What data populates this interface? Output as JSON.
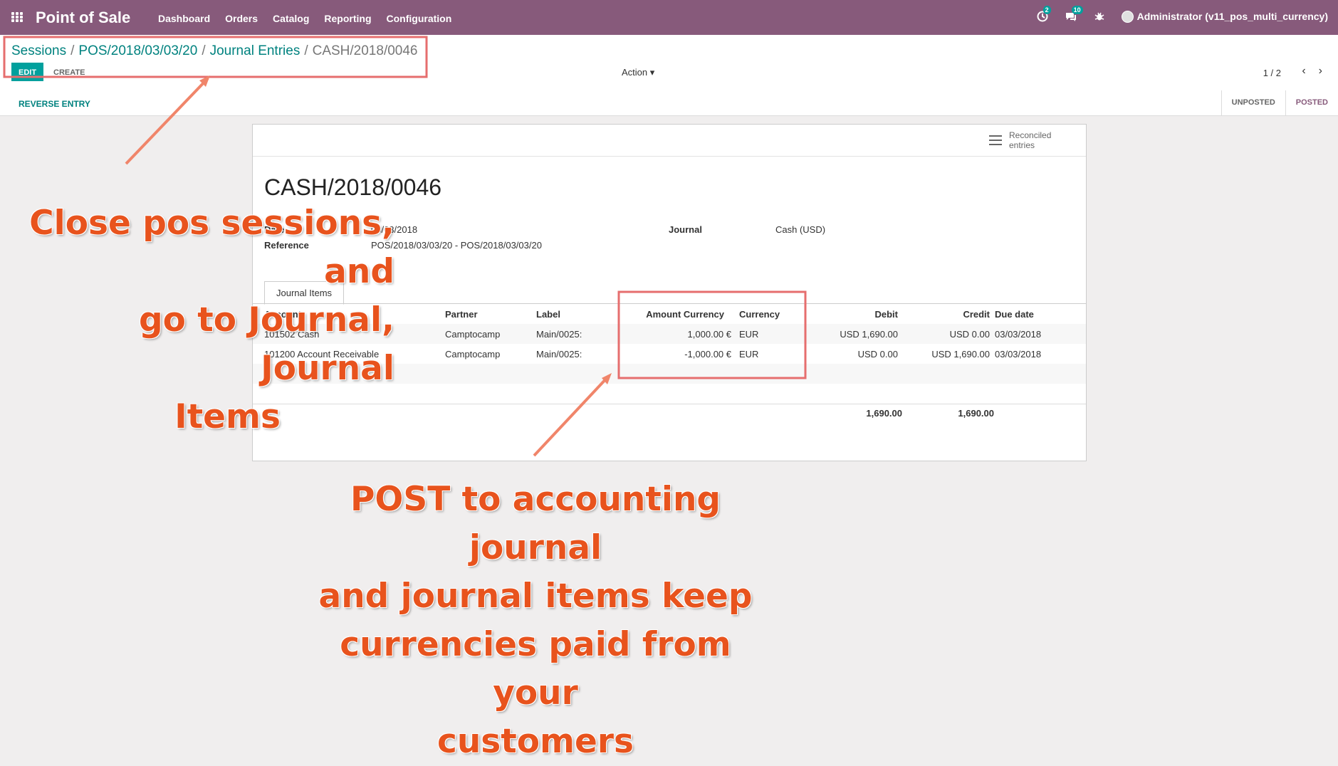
{
  "navbar": {
    "app_name": "Point of Sale",
    "menu": [
      "Dashboard",
      "Orders",
      "Catalog",
      "Reporting",
      "Configuration"
    ],
    "activity_count": "2",
    "messages_count": "10",
    "user": "Administrator (v11_pos_multi_currency)"
  },
  "breadcrumb": {
    "items": [
      "Sessions",
      "POS/2018/03/03/20",
      "Journal Entries"
    ],
    "current": "CASH/2018/0046"
  },
  "buttons": {
    "edit": "EDIT",
    "create": "CREATE",
    "action": "Action",
    "reverse": "REVERSE ENTRY"
  },
  "pager": {
    "value": "1 / 2"
  },
  "states": [
    "UNPOSTED",
    "POSTED"
  ],
  "stat_button": {
    "label": "Reconciled entries"
  },
  "record": {
    "name": "CASH/2018/0046",
    "date_label": "Date",
    "date_value": "03/03/2018",
    "reference_label": "Reference",
    "reference_value": "POS/2018/03/03/20 - POS/2018/03/03/20",
    "journal_label": "Journal",
    "journal_value": "Cash (USD)"
  },
  "tab": {
    "label": "Journal Items"
  },
  "table": {
    "headers": [
      "Account",
      "Partner",
      "Label",
      "Amount Currency",
      "Currency",
      "Debit",
      "Credit",
      "Due date"
    ],
    "rows": [
      [
        "101502 Cash",
        "Camptocamp",
        "Main/0025:",
        "1,000.00 €",
        "EUR",
        "USD 1,690.00",
        "USD 0.00",
        "03/03/2018"
      ],
      [
        "101200 Account Receivable",
        "Camptocamp",
        "Main/0025:",
        "-1,000.00 €",
        "EUR",
        "USD 0.00",
        "USD 1,690.00",
        "03/03/2018"
      ]
    ],
    "totals": {
      "debit": "1,690.00",
      "credit": "1,690.00"
    }
  },
  "annotations": {
    "left": [
      "Close pos sessions, and",
      "go to Journal, Journal",
      "Items"
    ],
    "bottom": [
      "POST to accounting journal",
      "and journal items keep",
      "currencies paid from your",
      "customers"
    ]
  },
  "colors": {
    "brand": "#875a7b",
    "accent": "#00a09d",
    "annotation": "#e8531d",
    "highlight_box": "#e66e6e"
  }
}
